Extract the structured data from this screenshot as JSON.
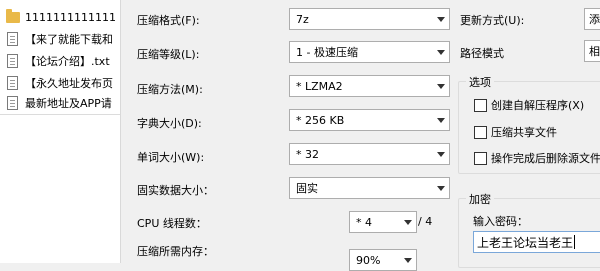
{
  "file_list": [
    {
      "name": "1111111111111",
      "type": "folder"
    },
    {
      "name": "【来了就能下载和",
      "type": "file"
    },
    {
      "name": "【论坛介绍】.txt",
      "type": "file"
    },
    {
      "name": "【永久地址发布页",
      "type": "file"
    },
    {
      "name": "最新地址及APP请",
      "type": "file"
    }
  ],
  "options": {
    "format": {
      "label": "压缩格式(F):",
      "value": "7z"
    },
    "level": {
      "label": "压缩等级(L):",
      "value": "1 - 极速压缩"
    },
    "method": {
      "label": "压缩方法(M):",
      "value": "* LZMA2"
    },
    "dict": {
      "label": "字典大小(D):",
      "value": "* 256 KB"
    },
    "word": {
      "label": "单词大小(W):",
      "value": "* 32"
    },
    "solid": {
      "label": "固实数据大小：",
      "value": "固实"
    },
    "threads": {
      "label": "CPU 线程数：",
      "value": "* 4",
      "of": "/ 4"
    },
    "memory": {
      "label": "压缩所需内存：",
      "value": "90%"
    }
  },
  "right": {
    "update_label": "更新方式(U):",
    "update_value": "添",
    "path_label": "路径模式",
    "path_value": "相",
    "options_group": "选项",
    "sfx": "创建自解压程序(X)",
    "shared": "压缩共享文件",
    "delete": "操作完成后删除源文件",
    "encrypt_group": "加密",
    "password_label": "输入密码：",
    "password_value": "上老王论坛当老王"
  }
}
